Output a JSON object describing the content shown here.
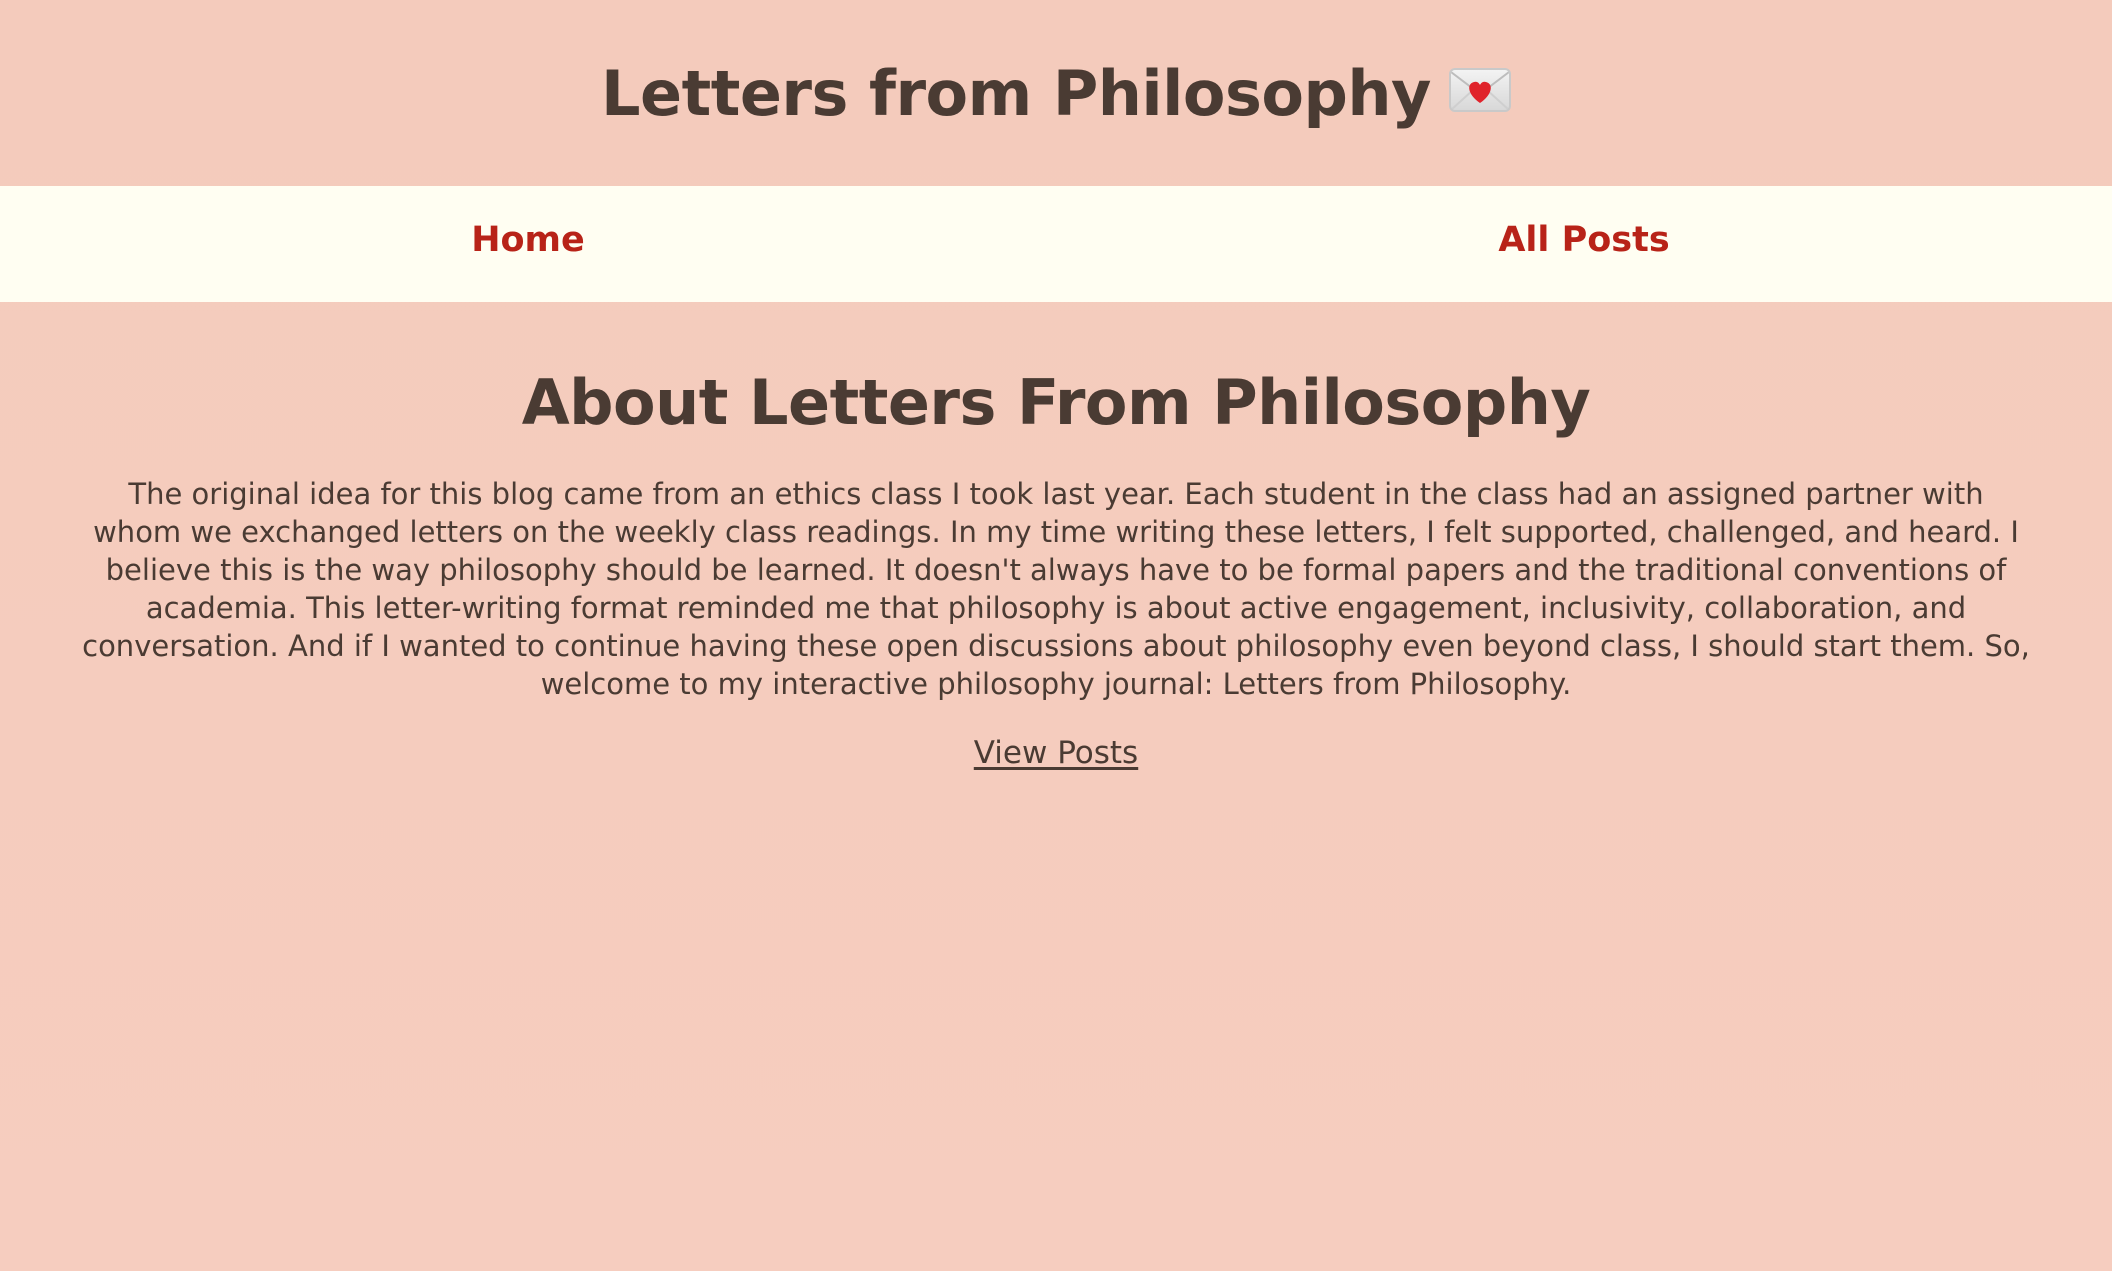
{
  "header": {
    "title": "Letters from Philosophy",
    "title_icon": "love-letter-icon"
  },
  "nav": {
    "items": [
      {
        "label": "Home"
      },
      {
        "label": "All Posts"
      }
    ]
  },
  "main": {
    "heading": "About Letters From Philosophy",
    "paragraph": "The original idea for this blog came from an ethics class I took last year. Each student in the class had an assigned partner with whom we exchanged letters on the weekly class readings. In my time writing these letters, I felt supported, challenged, and heard. I believe this is the way philosophy should be learned. It doesn't always have to be formal papers and the traditional conventions of academia. This letter-writing format reminded me that philosophy is about active engagement, inclusivity, collaboration, and conversation. And if I wanted to continue having these open discussions about philosophy even beyond class, I should start them. So, welcome to my interactive philosophy journal: Letters from Philosophy.",
    "link_label": "View Posts"
  },
  "colors": {
    "background": "#f5cdbf",
    "nav_background": "#fffef2",
    "nav_link": "#b82318",
    "text": "#4a3b33"
  }
}
